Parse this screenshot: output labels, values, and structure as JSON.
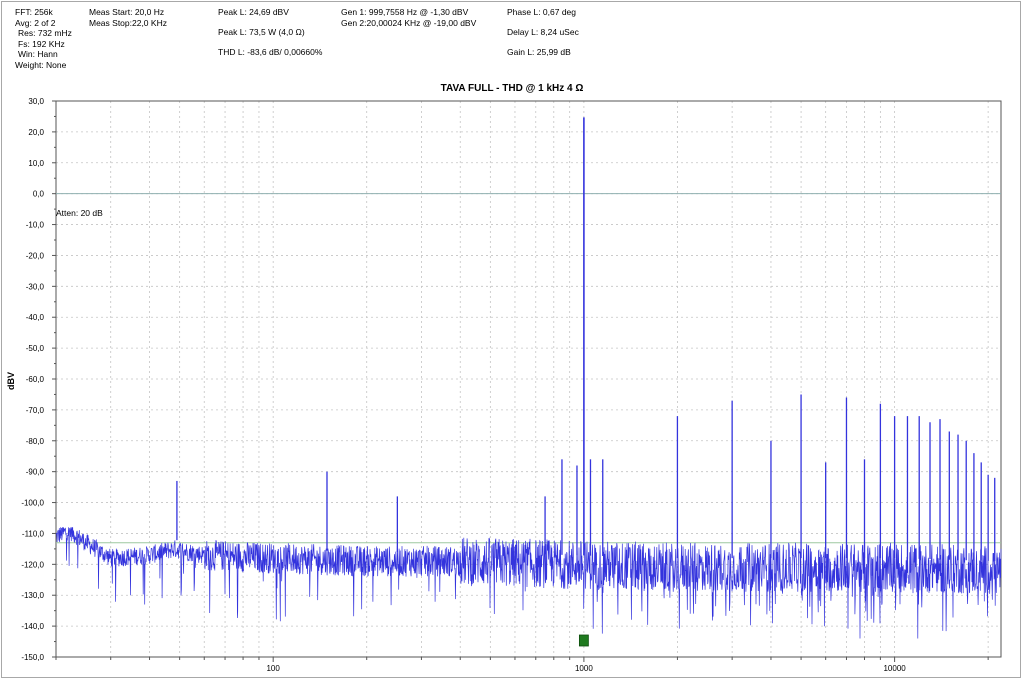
{
  "info_blocks": {
    "fft": [
      "FFT: 256k",
      "Avg: 2 of 2",
      "Res: 732 mHz",
      "Fs: 192 KHz",
      "Win: Hann",
      "Weight: None"
    ],
    "meas": [
      "Meas Start: 20,0 Hz",
      "Meas Stop:22,0 KHz"
    ],
    "peak": [
      "Peak L: 24,69 dBV",
      "Peak L: 73,5 W (4,0 Ω)",
      "THD L: -83,6 dB/ 0,00660%"
    ],
    "gen": [
      "Gen 1: 999,7558 Hz @ -1,30  dBV",
      "Gen 2:20,00024 KHz @ -19,00  dBV"
    ],
    "phase": [
      "Phase L: 0,67 deg",
      "Delay L: 8,24 uSec",
      "Gain L: 25,99 dB"
    ]
  },
  "chart_data": {
    "type": "line",
    "title": "TAVA FULL - THD @ 1 kHz 4 Ω",
    "ylabel": "dBV",
    "xlabel": "",
    "annotation": "Atten: 20 dB",
    "x_scale": "log",
    "xlim": [
      20,
      22000
    ],
    "ylim": [
      -150,
      30
    ],
    "y_ticks": [
      30,
      20,
      10,
      0,
      -10,
      -20,
      -30,
      -40,
      -50,
      -60,
      -70,
      -80,
      -90,
      -100,
      -110,
      -120,
      -130,
      -140,
      -150
    ],
    "y_tick_labels": [
      "30,0",
      "20,0",
      "10,0",
      "0,0",
      "-10,0",
      "-20,0",
      "-30,0",
      "-40,0",
      "-50,0",
      "-60,0",
      "-70,0",
      "-80,0",
      "-90,0",
      "-100,0",
      "-110,0",
      "-120,0",
      "-130,0",
      "-140,0",
      "-150,0"
    ],
    "x_tick_labels": [
      {
        "x": 100,
        "label": "100"
      },
      {
        "x": 1000,
        "label": "1000"
      },
      {
        "x": 10000,
        "label": "10000"
      }
    ],
    "reference_lines": [
      {
        "y": 0,
        "color": "#8fb0b0"
      },
      {
        "y": -113,
        "color": "#9ec8a0"
      }
    ],
    "marker": {
      "x": 1000,
      "color": "#1f7a1f"
    },
    "grid": true,
    "series": [
      {
        "color": "#3333dd",
        "noise_floor": [
          [
            20,
            -111
          ],
          [
            22,
            -109
          ],
          [
            25,
            -113
          ],
          [
            30,
            -118
          ],
          [
            40,
            -117
          ],
          [
            48,
            -115
          ],
          [
            60,
            -117
          ],
          [
            100,
            -118
          ],
          [
            200,
            -119
          ],
          [
            400,
            -119
          ],
          [
            900,
            -120
          ],
          [
            2000,
            -121
          ],
          [
            5000,
            -121
          ],
          [
            10000,
            -121
          ],
          [
            22000,
            -122
          ]
        ],
        "spikes": [
          {
            "x": 49,
            "y": -93
          },
          {
            "x": 149,
            "y": -90
          },
          {
            "x": 251,
            "y": -98
          },
          {
            "x": 750,
            "y": -98
          },
          {
            "x": 850,
            "y": -86
          },
          {
            "x": 950,
            "y": -88
          },
          {
            "x": 1000,
            "y": 24.7
          },
          {
            "x": 1050,
            "y": -86
          },
          {
            "x": 1150,
            "y": -86
          },
          {
            "x": 2000,
            "y": -72
          },
          {
            "x": 3000,
            "y": -67
          },
          {
            "x": 4000,
            "y": -80
          },
          {
            "x": 5000,
            "y": -65
          },
          {
            "x": 6000,
            "y": -87
          },
          {
            "x": 7000,
            "y": -66
          },
          {
            "x": 8000,
            "y": -86
          },
          {
            "x": 9000,
            "y": -68
          },
          {
            "x": 10000,
            "y": -72
          },
          {
            "x": 11000,
            "y": -72
          },
          {
            "x": 12000,
            "y": -72
          },
          {
            "x": 13000,
            "y": -74
          },
          {
            "x": 14000,
            "y": -73
          },
          {
            "x": 15000,
            "y": -77
          },
          {
            "x": 16000,
            "y": -78
          },
          {
            "x": 17000,
            "y": -80
          },
          {
            "x": 18000,
            "y": -84
          },
          {
            "x": 19000,
            "y": -87
          },
          {
            "x": 20000,
            "y": -91
          },
          {
            "x": 21000,
            "y": -92
          }
        ]
      }
    ]
  }
}
